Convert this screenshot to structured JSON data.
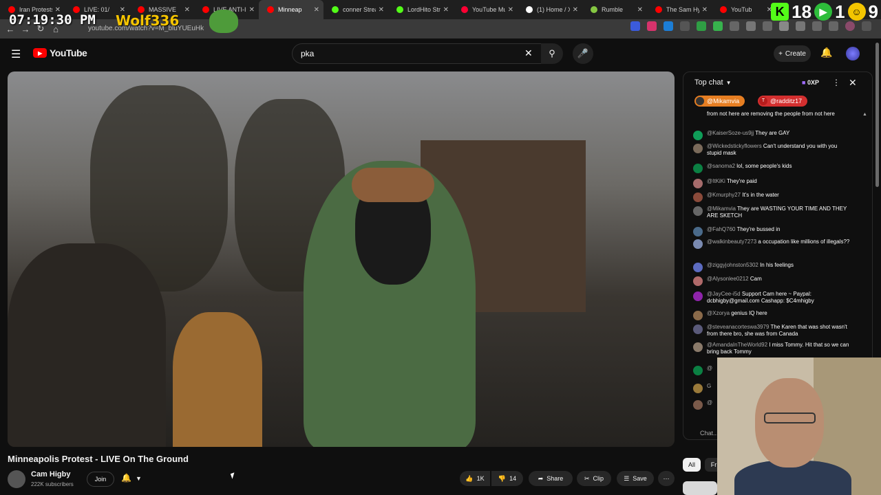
{
  "browser": {
    "tabs": [
      {
        "title": "Iran Protests",
        "color": "#ff0000"
      },
      {
        "title": "LIVE: 01/",
        "color": "#ff0000"
      },
      {
        "title": "MASSIVE",
        "color": "#ff0000"
      },
      {
        "title": "LIVE ANTI-IC",
        "color": "#ff0000"
      },
      {
        "title": "Minneap",
        "color": "#ff0000",
        "active": true
      },
      {
        "title": "conner Strea",
        "color": "#53fc18"
      },
      {
        "title": "LordHito Stre",
        "color": "#53fc18"
      },
      {
        "title": "YouTube Mu",
        "color": "#ff0033"
      },
      {
        "title": "(1) Home / X",
        "color": "#ffffff"
      },
      {
        "title": "Rumble",
        "color": "#85c742"
      },
      {
        "title": "The Sam Hy",
        "color": "#ff0000"
      },
      {
        "title": "YouTub",
        "color": "#ff0000"
      }
    ],
    "url": "youtube.com/watch?v=M_bluYUEuHk"
  },
  "overlay": {
    "clock": "07:19:30 PM",
    "streamer_tag": "Wolf336",
    "kick_count": "18",
    "rumble_count": "1",
    "face_count": "9"
  },
  "header": {
    "logo_text": "YouTube",
    "search_value": "pka",
    "create_label": "Create"
  },
  "video": {
    "title": "Minneapolis Protest - LIVE On The Ground",
    "channel": "Cam Higby",
    "subscribers": "222K subscribers",
    "join_label": "Join",
    "likes": "1K",
    "dislikes": "14",
    "share_label": "Share",
    "clip_label": "Clip",
    "save_label": "Save"
  },
  "chat": {
    "mode_label": "Top chat",
    "xp": "0XP",
    "pinned": [
      "@Mikamvia",
      "@radditz17"
    ],
    "input_placeholder": "Chat...",
    "messages": [
      {
        "author": "",
        "text": "from not here are removing the people from not here",
        "color": "#555"
      },
      {
        "author": "@KaiserSoze-us9jj",
        "text": "They are GAY",
        "color": "#0f9d58"
      },
      {
        "author": "@Wickedstickyflowers",
        "text": "Can't understand you with you stupid mask",
        "color": "#7a6a5a"
      },
      {
        "author": "@sanoma2",
        "text": "lol, some people's kids",
        "color": "#0b8043"
      },
      {
        "author": "@ItKiKi",
        "text": "They're paid",
        "color": "#a56b6b"
      },
      {
        "author": "@Kmurphy27",
        "text": "It's in the water",
        "color": "#8a4a3a"
      },
      {
        "author": "@Mikamvia",
        "text": "They are WASTING YOUR TIME AND THEY ARE SKETCH",
        "color": "#666"
      },
      {
        "author": "@FahQ760",
        "text": "They're bussed in",
        "color": "#4a6a8a"
      },
      {
        "author": "@walkinbeauty7273",
        "text": "a occupation like millions of illegals??",
        "color": "#7a8ab0"
      },
      {
        "author": "@ziggyjohnston5302",
        "text": "In his feelings",
        "color": "#5c6bc0"
      },
      {
        "author": "@Alysonlee0212",
        "text": "Cam",
        "color": "#b06a6a"
      },
      {
        "author": "@JayCee-i5d",
        "text": "Support Cam here ~ Paypal: dcbhigby@gmail.com Cashapp: $C4mhigby",
        "color": "#8e24aa"
      },
      {
        "author": "@Xzorya",
        "text": "genius IQ here",
        "color": "#8a6a4a"
      },
      {
        "author": "@steveanacorteswa3979",
        "text": "The Karen that was shot wasn't from there bro, she was from Canada",
        "color": "#5a5a7a"
      },
      {
        "author": "@AmandaInTheWorld92",
        "text": "I miss Tommy. Hit that so we can bring back Tommy",
        "color": "#8a7a6a"
      },
      {
        "author": "@",
        "text": "",
        "color": "#0b8043"
      },
      {
        "author": "G",
        "text": "",
        "color": "#9a7a3a"
      },
      {
        "author": "@",
        "text": "",
        "color": "#7a5a4a"
      }
    ]
  },
  "chips": {
    "all": "All",
    "fr": "Fr"
  }
}
